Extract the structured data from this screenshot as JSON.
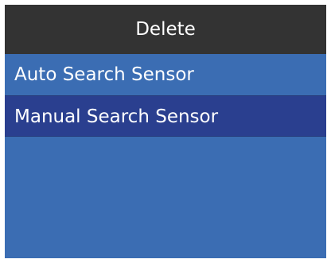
{
  "header": {
    "title": "Delete"
  },
  "menu": {
    "items": [
      {
        "label": "Auto Search Sensor",
        "selected": false
      },
      {
        "label": "Manual Search Sensor",
        "selected": true
      }
    ]
  },
  "colors": {
    "header_bg": "#333333",
    "screen_bg": "#3b6db3",
    "selected_bg": "#2a3f8f",
    "text": "#ffffff"
  }
}
